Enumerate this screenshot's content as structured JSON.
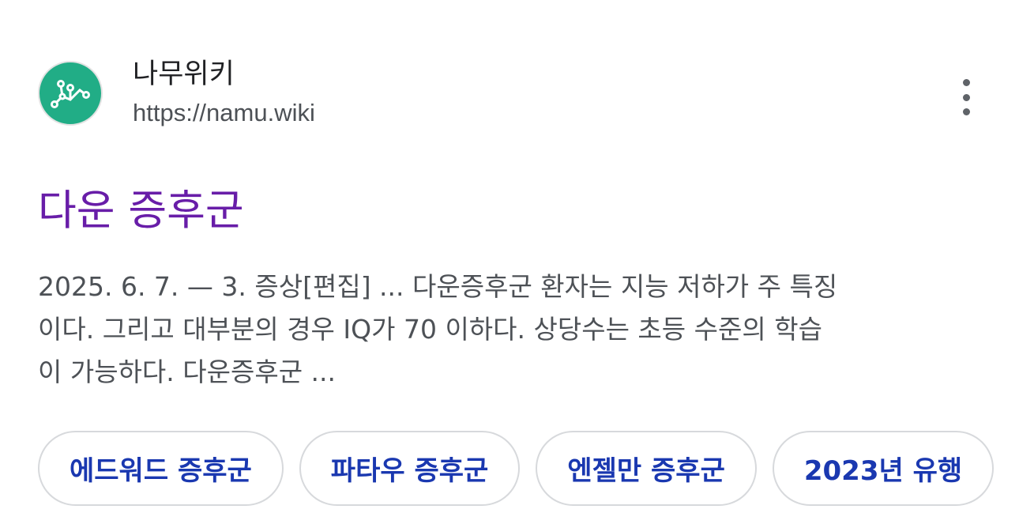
{
  "site": {
    "name": "나무위키",
    "url": "https://namu.wiki",
    "favicon_icon": "namu-wiki-logo-icon",
    "favicon_color": "#21ad86"
  },
  "more_icon": "more-vert-icon",
  "result": {
    "title": "다운 증후군",
    "title_color": "#681da8",
    "snippet_lines": [
      "2025. 6. 7. — 3. 증상[편집] ... 다운증후군 환자는 지능 저하가 주 특징",
      "이다. 그리고 대부분의 경우 IQ가 70 이하다. 상당수는 초등 수준의 학습",
      "이 가능하다. 다운증후군 ..."
    ]
  },
  "related_chips": [
    "에드워드 증후군",
    "파타우 증후군",
    "엔젤만 증후군",
    "2023년 유행"
  ],
  "chip_color": "#1a38b0"
}
